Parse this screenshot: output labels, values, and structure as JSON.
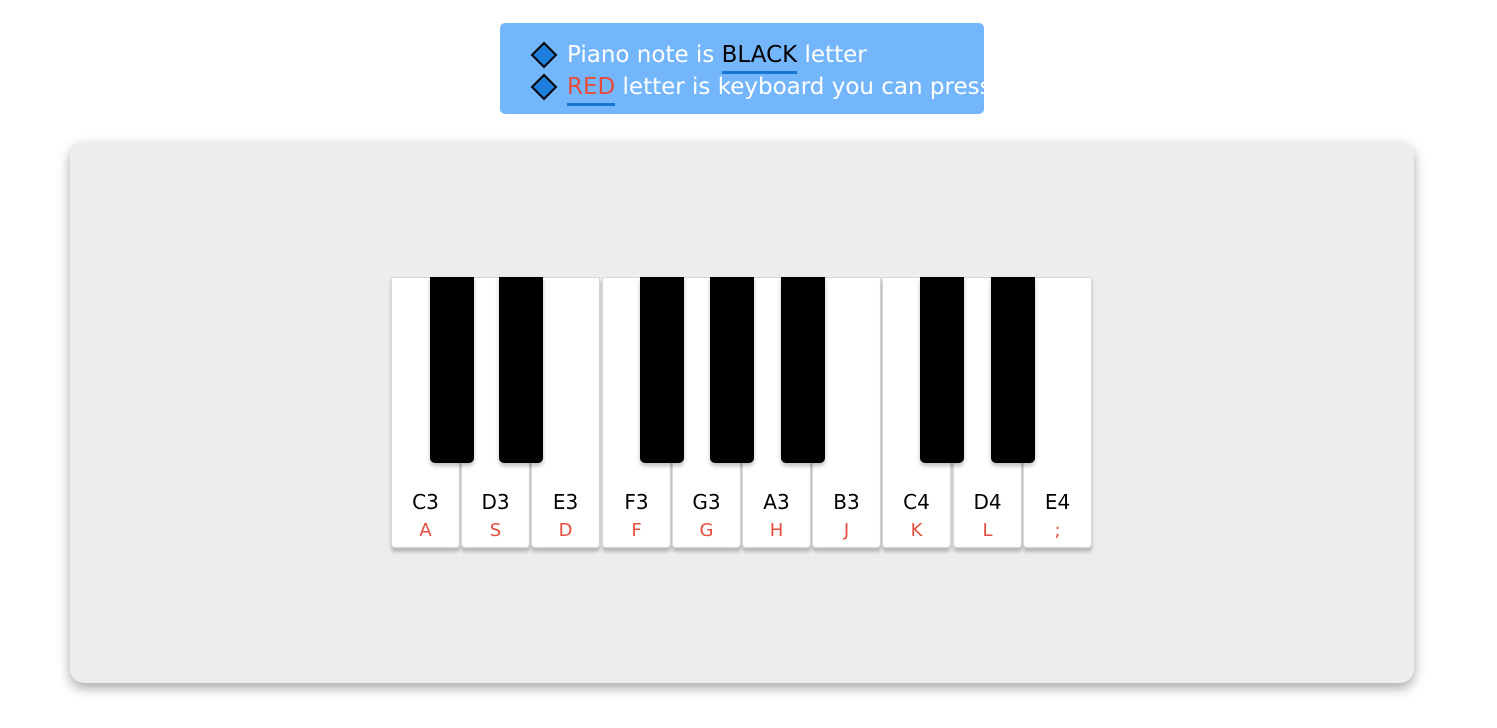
{
  "banner": {
    "line1_prefix": "Piano note is",
    "line1_highlight": "BLACK",
    "line1_suffix": "letter",
    "line2_highlight": "RED",
    "line2_suffix": "letter is keyboard you can press",
    "bullet_icon": "diamond-icon",
    "background_color": "#74b6fc",
    "underline_color": "#1976d2"
  },
  "piano": {
    "white_keys": [
      {
        "note": "C3",
        "key": "A"
      },
      {
        "note": "D3",
        "key": "S"
      },
      {
        "note": "E3",
        "key": "D"
      },
      {
        "note": "F3",
        "key": "F"
      },
      {
        "note": "G3",
        "key": "G"
      },
      {
        "note": "A3",
        "key": "H"
      },
      {
        "note": "B3",
        "key": "J"
      },
      {
        "note": "C4",
        "key": "K"
      },
      {
        "note": "D4",
        "key": "L"
      },
      {
        "note": "E4",
        "key": ";"
      }
    ],
    "note_color": "#000000",
    "key_label_color": "#e74c3c",
    "black_key_color": "#000000"
  }
}
